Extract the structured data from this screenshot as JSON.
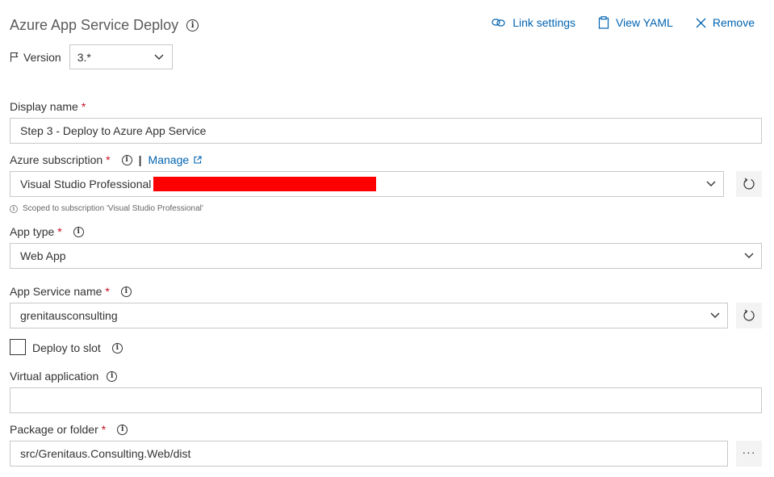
{
  "header": {
    "title": "Azure App Service Deploy",
    "toolbar": {
      "link_settings": "Link settings",
      "view_yaml": "View YAML",
      "remove": "Remove"
    }
  },
  "version": {
    "label": "Version",
    "value": "3.*"
  },
  "display_name": {
    "label": "Display name",
    "required": "*",
    "value": "Step 3 - Deploy to Azure App Service"
  },
  "azure_subscription": {
    "label": "Azure subscription",
    "required": "*",
    "separator": "|",
    "manage": "Manage",
    "value": "Visual Studio Professional",
    "scope_note": "Scoped to subscription 'Visual Studio Professional'"
  },
  "app_type": {
    "label": "App type",
    "required": "*",
    "value": "Web App"
  },
  "app_service_name": {
    "label": "App Service name",
    "required": "*",
    "value": "grenitausconsulting"
  },
  "deploy_to_slot": {
    "label": "Deploy to slot",
    "checked": false
  },
  "virtual_application": {
    "label": "Virtual application",
    "value": ""
  },
  "package_or_folder": {
    "label": "Package or folder",
    "required": "*",
    "value": "src/Grenitaus.Consulting.Web/dist",
    "browse": "···"
  },
  "colors": {
    "link": "#0063b1",
    "required": "#c50f1f",
    "redaction": "#ff0000"
  },
  "icons": [
    "info-icon",
    "link-icon",
    "clipboard-icon",
    "close-icon",
    "flag-icon",
    "chevron-down-icon",
    "refresh-icon",
    "external-link-icon"
  ]
}
